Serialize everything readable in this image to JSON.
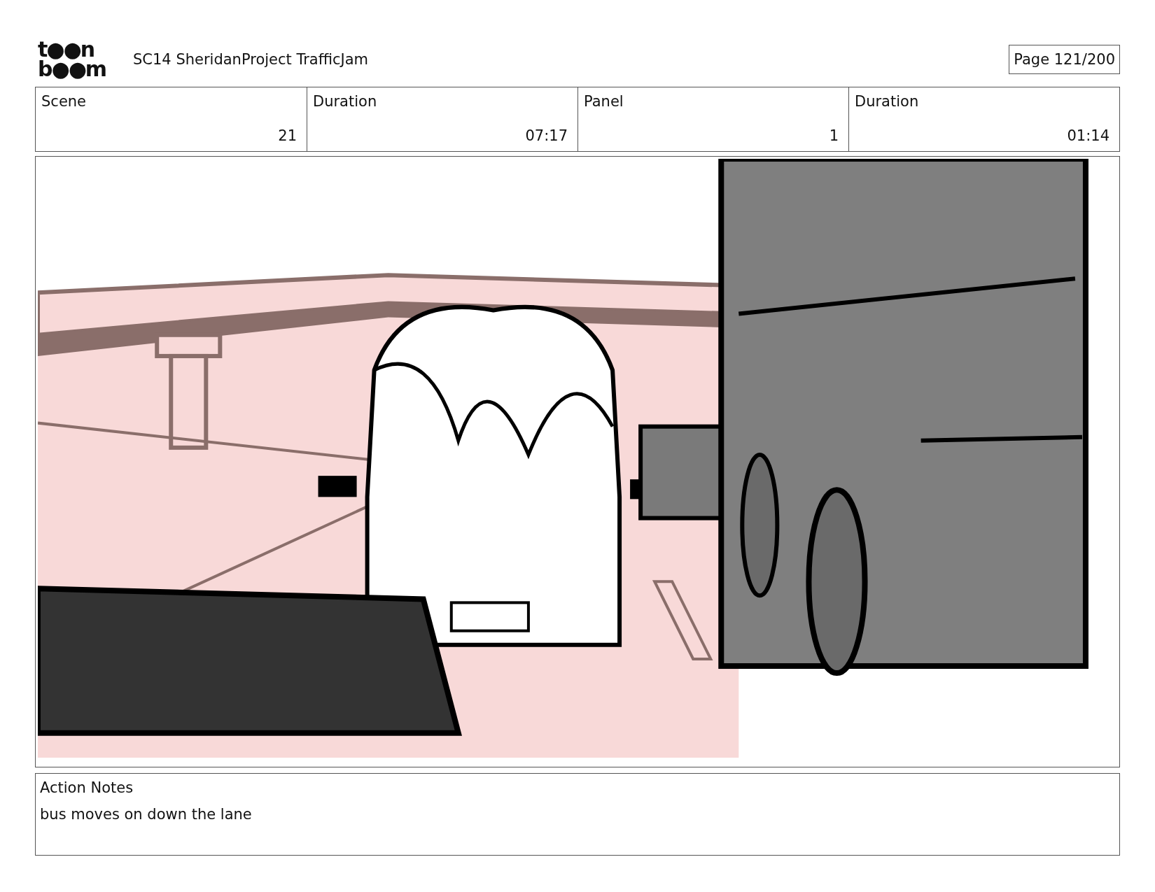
{
  "logo": {
    "top": "t●●n",
    "bottom": "b●●m"
  },
  "title": "SC14 SheridanProject TrafficJam",
  "page": "Page 121/200",
  "fields": [
    {
      "label": "Scene",
      "value": "21"
    },
    {
      "label": "Duration",
      "value": "07:17"
    },
    {
      "label": "Panel",
      "value": "1"
    },
    {
      "label": "Duration",
      "value": "01:14"
    }
  ],
  "notes": {
    "label": "Action Notes",
    "text": "bus moves on down the lane"
  }
}
